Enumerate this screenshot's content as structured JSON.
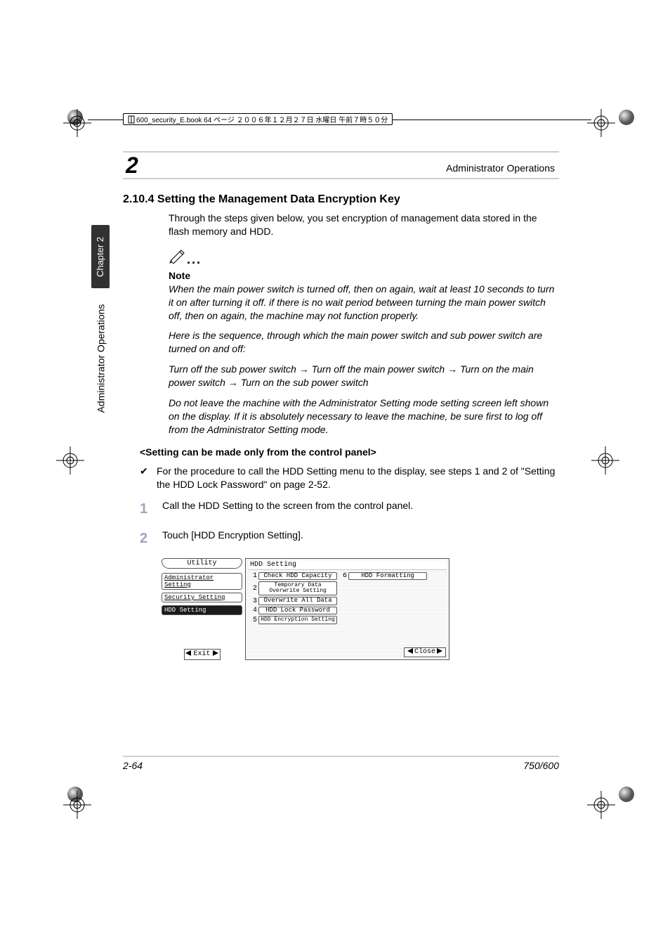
{
  "topline_label": "600_security_E.book 64 ページ ２００６年１２月２７日 水曜日 午前７時５０分",
  "header": {
    "chapter_num": "2",
    "section_name": "Administrator Operations"
  },
  "side_tab_dark": "Chapter 2",
  "side_tab_text": "Administrator Operations",
  "heading": "2.10.4  Setting the Management Data Encryption Key",
  "intro": "Through the steps given below, you set encryption of management data stored in the flash memory and HDD.",
  "note": {
    "label": "Note",
    "p1": "When the main power switch is turned off, then on again, wait at least 10 seconds to turn it on after turning it off. if there is no wait period between turning the main power switch off, then on again, the machine may not function properly.",
    "p2": "Here is the sequence, through which the main power switch and sub power switch are turned on and off:",
    "p3": "Turn off the sub power switch → Turn off the main power switch → Turn on the main power switch → Turn on the sub power switch",
    "p4": "Do not leave the machine with the Administrator Setting mode setting screen left shown on the display. If it is absolutely necessary to leave the machine, be sure first to log off from the Administrator Setting mode."
  },
  "subhead": "<Setting can be made only from the control panel>",
  "bullet": "For the procedure to call the HDD Setting menu to the display, see steps 1 and 2 of \"Setting the HDD Lock Password\" on page 2-52.",
  "steps": {
    "s1": {
      "n": "1",
      "t": "Call the HDD Setting to the screen from the control panel."
    },
    "s2": {
      "n": "2",
      "t": "Touch [HDD Encryption Setting]."
    }
  },
  "panel": {
    "left_title": "Utility",
    "left_btns": {
      "b1": "Administrator Setting",
      "b2": "Security Setting",
      "b3": "HDD Setting"
    },
    "exit": "Exit",
    "right_title": "HDD Setting",
    "opts": {
      "o1": {
        "n": "1",
        "t": "Check HDD Capacity"
      },
      "o2": {
        "n": "2",
        "t": "Temporary Data Overwrite Setting"
      },
      "o3": {
        "n": "3",
        "t": "Overwrite All Data"
      },
      "o4": {
        "n": "4",
        "t": "HDD Lock Password"
      },
      "o5": {
        "n": "5",
        "t": "HDD Encryption Setting"
      },
      "o6": {
        "n": "6",
        "t": "HDD Formatting"
      }
    },
    "close": "Close"
  },
  "footer": {
    "page": "2-64",
    "model": "750/600"
  }
}
